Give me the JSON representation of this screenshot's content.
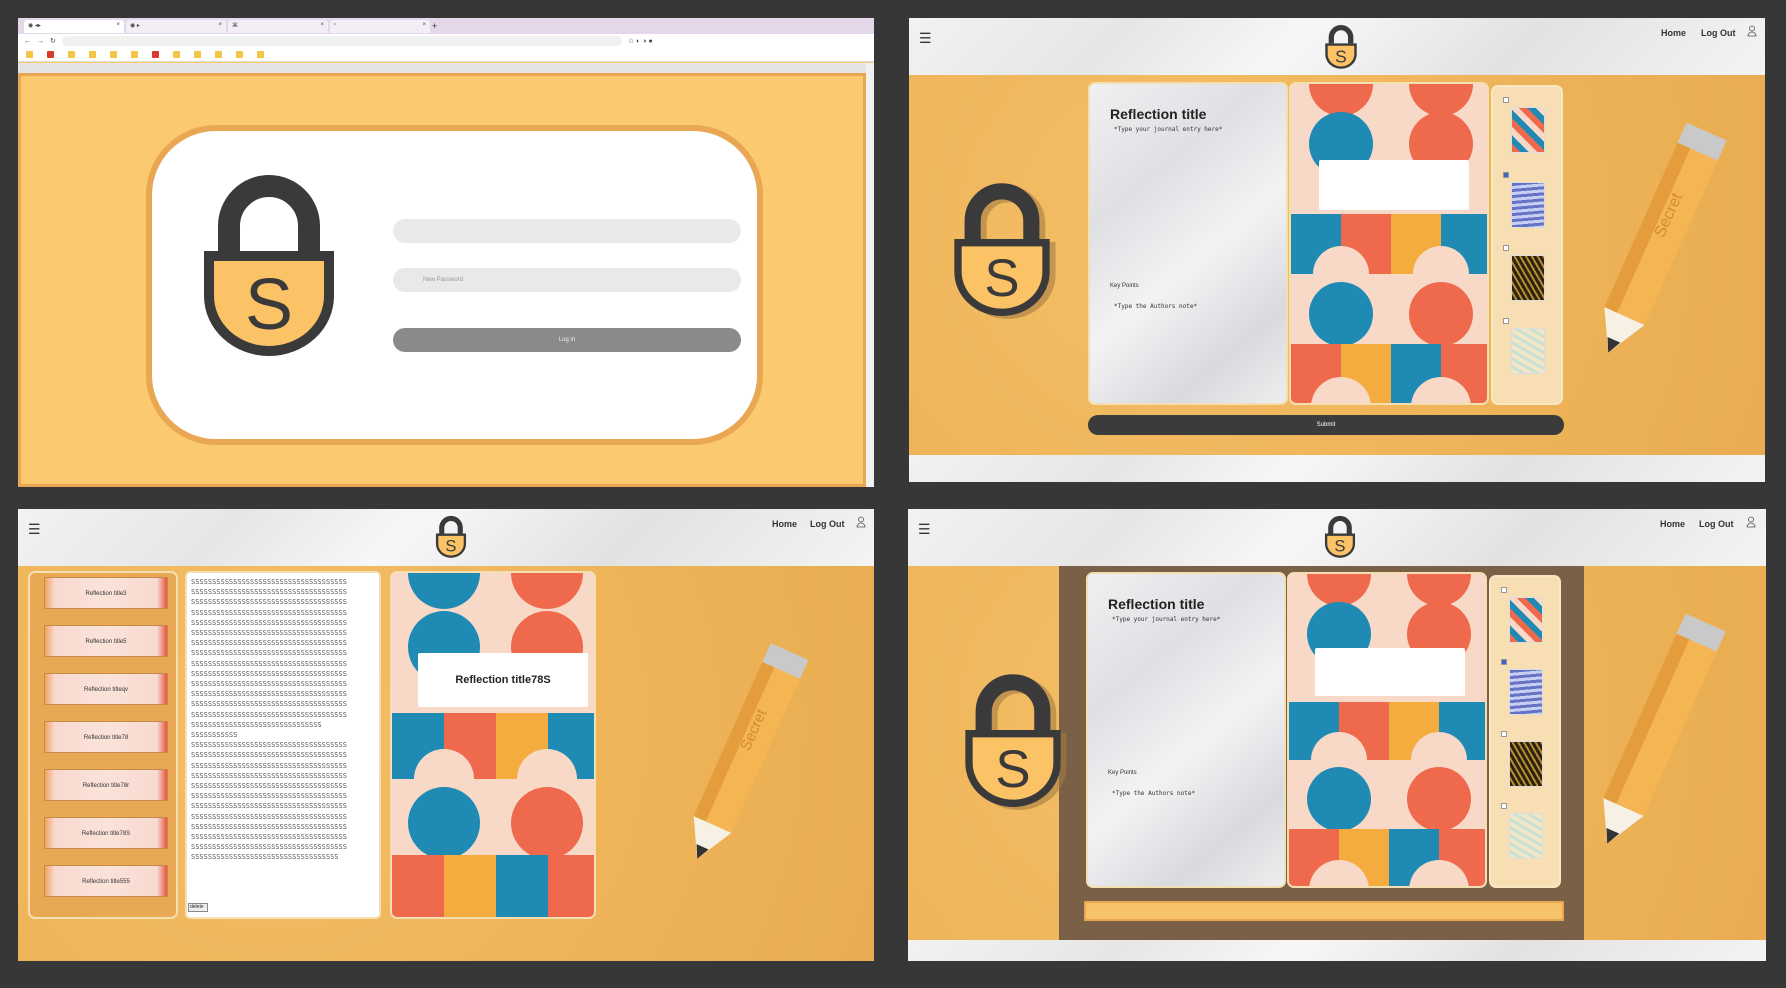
{
  "login_panel": {
    "password_placeholder": "New Password",
    "login_button": "Log in"
  },
  "header": {
    "home": "Home",
    "logout": "Log Out"
  },
  "logo_letter": "S",
  "pencil_text": "Secret",
  "journal": {
    "title": "Reflection title",
    "entry_placeholder": "*Type your journal entry here*",
    "key_points_label": "Key Points",
    "authors_note_placeholder": "*Type the Authors note*",
    "submit": "Submit"
  },
  "library": {
    "books": [
      "Reflection title3",
      "Reflection title5",
      "Reflection titleqv",
      "Reflection title78",
      "Reflection title78r",
      "Reflection title78S",
      "Reflection title555"
    ],
    "text_lines": [
      "SSSSSSSSSSSSSSSSSSSSSSSSSSSSSSSSSSSSS",
      "SSSSSSSSSSSSSSSSSSSSSSSSSSSSSSSSSSSSS",
      "SSSSSSSSSSSSSSSSSSSSSSSSSSSSSSSSSSSSS",
      "SSSSSSSSSSSSSSSSSSSSSSSSSSSSSSSSSSSSS",
      "SSSSSSSSSSSSSSSSSSSSSSSSSSSSSSSSSSSSS",
      "SSSSSSSSSSSSSSSSSSSSSSSSSSSSSSSSSSSSS",
      "SSSSSSSSSSSSSSSSSSSSSSSSSSSSSSSSSSSSS",
      "SSSSSSSSSSSSSSSSSSSSSSSSSSSSSSSSSSSSS",
      "SSSSSSSSSSSSSSSSSSSSSSSSSSSSSSSSSSSSS",
      "SSSSSSSSSSSSSSSSSSSSSSSSSSSSSSSSSSSSS",
      "SSSSSSSSSSSSSSSSSSSSSSSSSSSSSSSSSSSSS",
      "SSSSSSSSSSSSSSSSSSSSSSSSSSSSSSSSSSSSS",
      "SSSSSSSSSSSSSSSSSSSSSSSSSSSSSSSSSSSSS",
      "SSSSSSSSSSSSSSSSSSSSSSSSSSSSSSSSSSSSS",
      "SSSSSSSSSSSSSSSSSSSSSSSSSSSSSSS",
      "SSSSSSSSSSS",
      "SSSSSSSSSSSSSSSSSSSSSSSSSSSSSSSSSSSSS",
      "SSSSSSSSSSSSSSSSSSSSSSSSSSSSSSSSSSSSS",
      "SSSSSSSSSSSSSSSSSSSSSSSSSSSSSSSSSSSSS",
      "SSSSSSSSSSSSSSSSSSSSSSSSSSSSSSSSSSSSS",
      "SSSSSSSSSSSSSSSSSSSSSSSSSSSSSSSSSSSSS",
      "SSSSSSSSSSSSSSSSSSSSSSSSSSSSSSSSSSSSS",
      "SSSSSSSSSSSSSSSSSSSSSSSSSSSSSSSSSSSSS",
      "SSSSSSSSSSSSSSSSSSSSSSSSSSSSSSSSSSSSS",
      "SSSSSSSSSSSSSSSSSSSSSSSSSSSSSSSSSSSSS",
      "SSSSSSSSSSSSSSSSSSSSSSSSSSSSSSSSSSSSS",
      "SSSSSSSSSSSSSSSSSSSSSSSSSSSSSSSSSSSSS",
      "SSSSSSSSSSSSSSSSSSSSSSSSSSSSSSSSSSS"
    ],
    "delete": "delete",
    "selected_title": "Reflection title78S"
  },
  "colors": {
    "orange": "#efb55a",
    "dark": "#3b3b3b",
    "teal": "#1f8ab3",
    "coral": "#ef6a4d",
    "peach": "#f8d9c8",
    "gold": "#f5ac3f"
  },
  "icons": [
    "hamburger-icon",
    "user-icon",
    "padlock-logo-icon",
    "pencil-icon"
  ]
}
